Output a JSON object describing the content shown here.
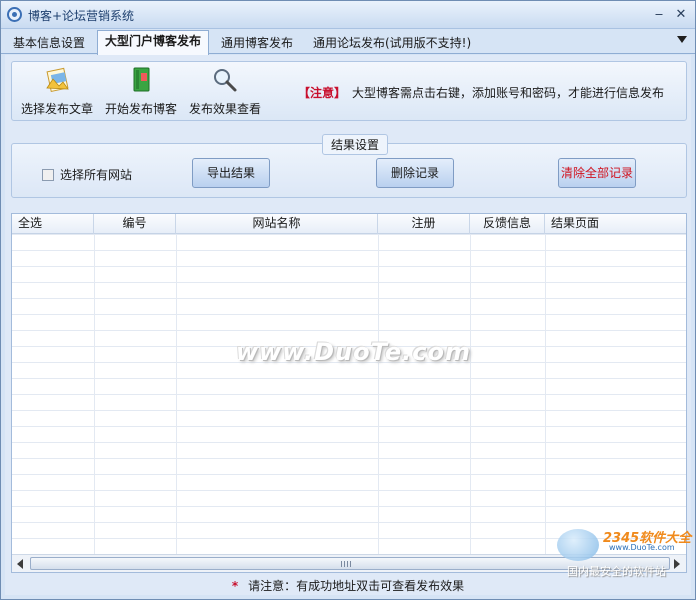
{
  "window": {
    "title": "博客+论坛营销系统"
  },
  "tabs": [
    {
      "label": "基本信息设置"
    },
    {
      "label": "大型门户博客发布"
    },
    {
      "label": "通用博客发布"
    },
    {
      "label": "通用论坛发布(试用版不支持!)"
    }
  ],
  "toolbar": {
    "select_article": "选择发布文章",
    "start_publish": "开始发布博客",
    "view_results": "发布效果查看",
    "notice_tag": "【注意】",
    "notice_text": "大型博客需点击右键，添加账号和密码，才能进行信息发布"
  },
  "results": {
    "group_label": "结果设置",
    "select_all_sites": "选择所有网站",
    "export_button": "导出结果",
    "delete_button": "删除记录",
    "clear_button": "清除全部记录"
  },
  "table": {
    "columns": [
      "全选",
      "编号",
      "网站名称",
      "注册",
      "反馈信息",
      "结果页面"
    ],
    "rows": []
  },
  "watermark": "www.DuoTe.com",
  "footer": {
    "star": "*",
    "text": "请注意：有成功地址双击可查看发布效果"
  },
  "brand": {
    "name": "2345软件大全",
    "url": "www.DuoTe.com",
    "slogan": "国内最安全的软件站"
  },
  "colors": {
    "notice": "#c8102e",
    "clear_button": "#d0121e",
    "tab_active_bg": "#f6f9fe"
  }
}
